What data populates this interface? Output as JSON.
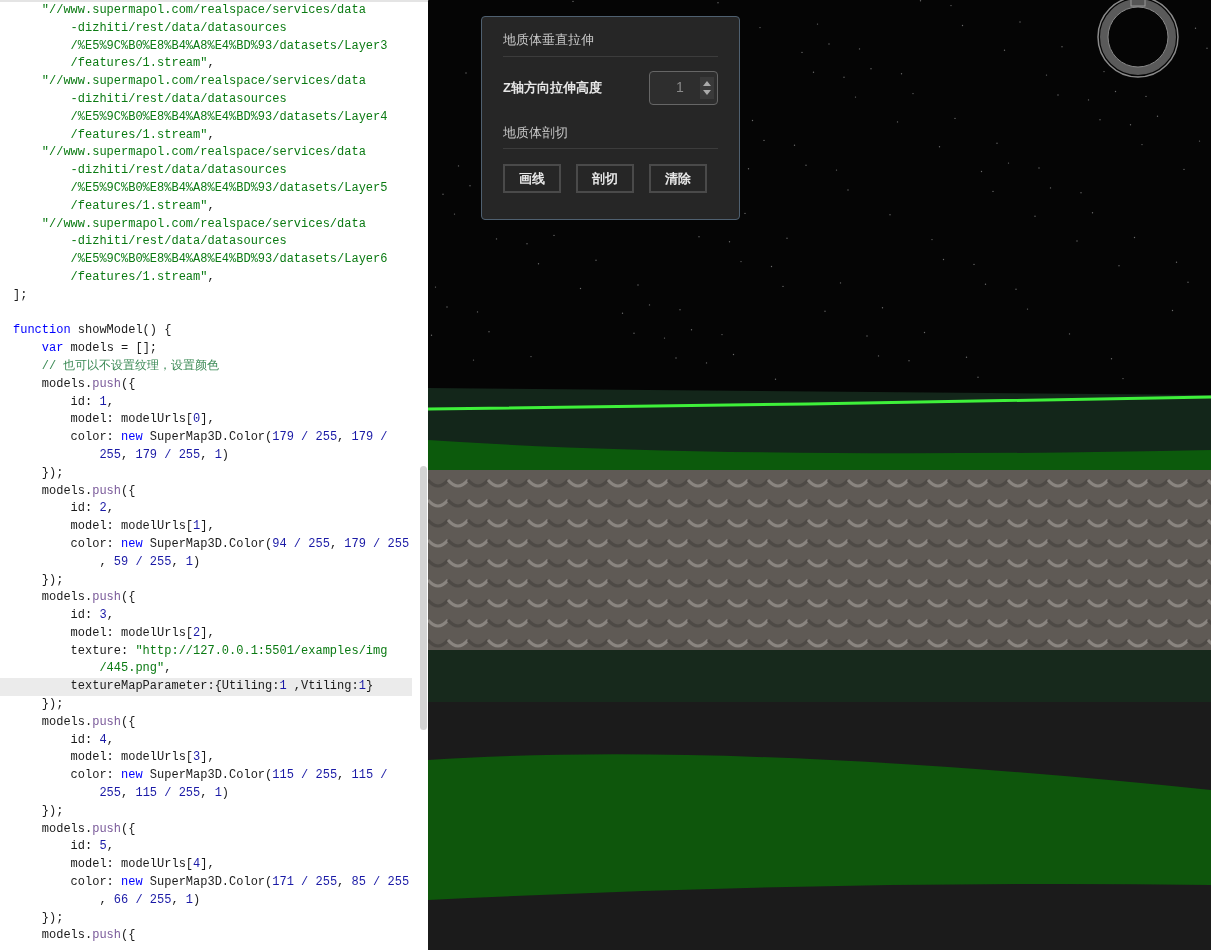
{
  "editor": {
    "lines": [
      {
        "kind": "code",
        "current": false,
        "segments": [
          {
            "kind": "string",
            "text": "    \"//www.supermapol.com/realspace/services/data"
          }
        ]
      },
      {
        "kind": "code",
        "current": false,
        "segments": [
          {
            "kind": "string",
            "text": "        -dizhiti/rest/data/datasources"
          }
        ]
      },
      {
        "kind": "code",
        "current": false,
        "segments": [
          {
            "kind": "string",
            "text": "        /%E5%9C%B0%E8%B4%A8%E4%BD%93/datasets/Layer3"
          }
        ]
      },
      {
        "kind": "code",
        "current": false,
        "segments": [
          {
            "kind": "string",
            "text": "        /features/1.stream\""
          },
          {
            "kind": "plain",
            "text": ","
          }
        ]
      },
      {
        "kind": "code",
        "current": false,
        "segments": [
          {
            "kind": "string",
            "text": "    \"//www.supermapol.com/realspace/services/data"
          }
        ]
      },
      {
        "kind": "code",
        "current": false,
        "segments": [
          {
            "kind": "string",
            "text": "        -dizhiti/rest/data/datasources"
          }
        ]
      },
      {
        "kind": "code",
        "current": false,
        "segments": [
          {
            "kind": "string",
            "text": "        /%E5%9C%B0%E8%B4%A8%E4%BD%93/datasets/Layer4"
          }
        ]
      },
      {
        "kind": "code",
        "current": false,
        "segments": [
          {
            "kind": "string",
            "text": "        /features/1.stream\""
          },
          {
            "kind": "plain",
            "text": ","
          }
        ]
      },
      {
        "kind": "code",
        "current": false,
        "segments": [
          {
            "kind": "string",
            "text": "    \"//www.supermapol.com/realspace/services/data"
          }
        ]
      },
      {
        "kind": "code",
        "current": false,
        "segments": [
          {
            "kind": "string",
            "text": "        -dizhiti/rest/data/datasources"
          }
        ]
      },
      {
        "kind": "code",
        "current": false,
        "segments": [
          {
            "kind": "string",
            "text": "        /%E5%9C%B0%E8%B4%A8%E4%BD%93/datasets/Layer5"
          }
        ]
      },
      {
        "kind": "code",
        "current": false,
        "segments": [
          {
            "kind": "string",
            "text": "        /features/1.stream\""
          },
          {
            "kind": "plain",
            "text": ","
          }
        ]
      },
      {
        "kind": "code",
        "current": false,
        "segments": [
          {
            "kind": "string",
            "text": "    \"//www.supermapol.com/realspace/services/data"
          }
        ]
      },
      {
        "kind": "code",
        "current": false,
        "segments": [
          {
            "kind": "string",
            "text": "        -dizhiti/rest/data/datasources"
          }
        ]
      },
      {
        "kind": "code",
        "current": false,
        "segments": [
          {
            "kind": "string",
            "text": "        /%E5%9C%B0%E8%B4%A8%E4%BD%93/datasets/Layer6"
          }
        ]
      },
      {
        "kind": "code",
        "current": false,
        "segments": [
          {
            "kind": "string",
            "text": "        /features/1.stream\""
          },
          {
            "kind": "plain",
            "text": ","
          }
        ]
      },
      {
        "kind": "code",
        "current": false,
        "segments": [
          {
            "kind": "plain",
            "text": "];"
          }
        ]
      },
      {
        "kind": "blank"
      },
      {
        "kind": "code",
        "current": false,
        "segments": [
          {
            "kind": "keyword",
            "text": "function"
          },
          {
            "kind": "plain",
            "text": " showModel() {"
          }
        ]
      },
      {
        "kind": "code",
        "current": false,
        "segments": [
          {
            "kind": "keyword",
            "text": "    var"
          },
          {
            "kind": "plain",
            "text": " models = [];"
          }
        ]
      },
      {
        "kind": "code",
        "current": false,
        "segments": [
          {
            "kind": "comment",
            "text": "    // 也可以不设置纹理，设置颜色"
          }
        ]
      },
      {
        "kind": "code",
        "current": false,
        "segments": [
          {
            "kind": "plain",
            "text": "    models."
          },
          {
            "kind": "method",
            "text": "push"
          },
          {
            "kind": "plain",
            "text": "({"
          }
        ]
      },
      {
        "kind": "code",
        "current": false,
        "segments": [
          {
            "kind": "plain",
            "text": "        id: "
          },
          {
            "kind": "number",
            "text": "1"
          },
          {
            "kind": "plain",
            "text": ","
          }
        ]
      },
      {
        "kind": "code",
        "current": false,
        "segments": [
          {
            "kind": "plain",
            "text": "        model: modelUrls["
          },
          {
            "kind": "number",
            "text": "0"
          },
          {
            "kind": "plain",
            "text": "],"
          }
        ]
      },
      {
        "kind": "code",
        "current": false,
        "segments": [
          {
            "kind": "plain",
            "text": "        color: "
          },
          {
            "kind": "keyword",
            "text": "new"
          },
          {
            "kind": "plain",
            "text": " SuperMap3D.Color("
          },
          {
            "kind": "number",
            "text": "179 / 255"
          },
          {
            "kind": "plain",
            "text": ", "
          },
          {
            "kind": "number",
            "text": "179 /"
          }
        ]
      },
      {
        "kind": "code",
        "current": false,
        "segments": [
          {
            "kind": "number",
            "text": "            255"
          },
          {
            "kind": "plain",
            "text": ", "
          },
          {
            "kind": "number",
            "text": "179 / 255"
          },
          {
            "kind": "plain",
            "text": ", "
          },
          {
            "kind": "number",
            "text": "1"
          },
          {
            "kind": "plain",
            "text": ")"
          }
        ]
      },
      {
        "kind": "code",
        "current": false,
        "segments": [
          {
            "kind": "plain",
            "text": "    });"
          }
        ]
      },
      {
        "kind": "code",
        "current": false,
        "segments": [
          {
            "kind": "plain",
            "text": "    models."
          },
          {
            "kind": "method",
            "text": "push"
          },
          {
            "kind": "plain",
            "text": "({"
          }
        ]
      },
      {
        "kind": "code",
        "current": false,
        "segments": [
          {
            "kind": "plain",
            "text": "        id: "
          },
          {
            "kind": "number",
            "text": "2"
          },
          {
            "kind": "plain",
            "text": ","
          }
        ]
      },
      {
        "kind": "code",
        "current": false,
        "segments": [
          {
            "kind": "plain",
            "text": "        model: modelUrls["
          },
          {
            "kind": "number",
            "text": "1"
          },
          {
            "kind": "plain",
            "text": "],"
          }
        ]
      },
      {
        "kind": "code",
        "current": false,
        "segments": [
          {
            "kind": "plain",
            "text": "        color: "
          },
          {
            "kind": "keyword",
            "text": "new"
          },
          {
            "kind": "plain",
            "text": " SuperMap3D.Color("
          },
          {
            "kind": "number",
            "text": "94 / 255"
          },
          {
            "kind": "plain",
            "text": ", "
          },
          {
            "kind": "number",
            "text": "179 / 255"
          }
        ]
      },
      {
        "kind": "code",
        "current": false,
        "segments": [
          {
            "kind": "plain",
            "text": "            , "
          },
          {
            "kind": "number",
            "text": "59 / 255"
          },
          {
            "kind": "plain",
            "text": ", "
          },
          {
            "kind": "number",
            "text": "1"
          },
          {
            "kind": "plain",
            "text": ")"
          }
        ]
      },
      {
        "kind": "code",
        "current": false,
        "segments": [
          {
            "kind": "plain",
            "text": "    });"
          }
        ]
      },
      {
        "kind": "code",
        "current": false,
        "segments": [
          {
            "kind": "plain",
            "text": "    models."
          },
          {
            "kind": "method",
            "text": "push"
          },
          {
            "kind": "plain",
            "text": "({"
          }
        ]
      },
      {
        "kind": "code",
        "current": false,
        "segments": [
          {
            "kind": "plain",
            "text": "        id: "
          },
          {
            "kind": "number",
            "text": "3"
          },
          {
            "kind": "plain",
            "text": ","
          }
        ]
      },
      {
        "kind": "code",
        "current": false,
        "segments": [
          {
            "kind": "plain",
            "text": "        model: modelUrls["
          },
          {
            "kind": "number",
            "text": "2"
          },
          {
            "kind": "plain",
            "text": "],"
          }
        ]
      },
      {
        "kind": "code",
        "current": false,
        "segments": [
          {
            "kind": "plain",
            "text": "        texture: "
          },
          {
            "kind": "string",
            "text": "\"http://127.0.0.1:5501/examples/img"
          }
        ]
      },
      {
        "kind": "code",
        "current": false,
        "segments": [
          {
            "kind": "string",
            "text": "            /445.png\""
          },
          {
            "kind": "plain",
            "text": ","
          }
        ]
      },
      {
        "kind": "code",
        "current": true,
        "segments": [
          {
            "kind": "plain",
            "text": "        textureMapParameter:{Utiling:"
          },
          {
            "kind": "number",
            "text": "1"
          },
          {
            "kind": "plain",
            "text": " ,Vtiling:"
          },
          {
            "kind": "number",
            "text": "1"
          },
          {
            "kind": "plain",
            "text": "}"
          }
        ]
      },
      {
        "kind": "code",
        "current": false,
        "segments": [
          {
            "kind": "plain",
            "text": "    });"
          }
        ]
      },
      {
        "kind": "code",
        "current": false,
        "segments": [
          {
            "kind": "plain",
            "text": "    models."
          },
          {
            "kind": "method",
            "text": "push"
          },
          {
            "kind": "plain",
            "text": "({"
          }
        ]
      },
      {
        "kind": "code",
        "current": false,
        "segments": [
          {
            "kind": "plain",
            "text": "        id: "
          },
          {
            "kind": "number",
            "text": "4"
          },
          {
            "kind": "plain",
            "text": ","
          }
        ]
      },
      {
        "kind": "code",
        "current": false,
        "segments": [
          {
            "kind": "plain",
            "text": "        model: modelUrls["
          },
          {
            "kind": "number",
            "text": "3"
          },
          {
            "kind": "plain",
            "text": "],"
          }
        ]
      },
      {
        "kind": "code",
        "current": false,
        "segments": [
          {
            "kind": "plain",
            "text": "        color: "
          },
          {
            "kind": "keyword",
            "text": "new"
          },
          {
            "kind": "plain",
            "text": " SuperMap3D.Color("
          },
          {
            "kind": "number",
            "text": "115 / 255"
          },
          {
            "kind": "plain",
            "text": ", "
          },
          {
            "kind": "number",
            "text": "115 /"
          }
        ]
      },
      {
        "kind": "code",
        "current": false,
        "segments": [
          {
            "kind": "number",
            "text": "            255"
          },
          {
            "kind": "plain",
            "text": ", "
          },
          {
            "kind": "number",
            "text": "115 / 255"
          },
          {
            "kind": "plain",
            "text": ", "
          },
          {
            "kind": "number",
            "text": "1"
          },
          {
            "kind": "plain",
            "text": ")"
          }
        ]
      },
      {
        "kind": "code",
        "current": false,
        "segments": [
          {
            "kind": "plain",
            "text": "    });"
          }
        ]
      },
      {
        "kind": "code",
        "current": false,
        "segments": [
          {
            "kind": "plain",
            "text": "    models."
          },
          {
            "kind": "method",
            "text": "push"
          },
          {
            "kind": "plain",
            "text": "({"
          }
        ]
      },
      {
        "kind": "code",
        "current": false,
        "segments": [
          {
            "kind": "plain",
            "text": "        id: "
          },
          {
            "kind": "number",
            "text": "5"
          },
          {
            "kind": "plain",
            "text": ","
          }
        ]
      },
      {
        "kind": "code",
        "current": false,
        "segments": [
          {
            "kind": "plain",
            "text": "        model: modelUrls["
          },
          {
            "kind": "number",
            "text": "4"
          },
          {
            "kind": "plain",
            "text": "],"
          }
        ]
      },
      {
        "kind": "code",
        "current": false,
        "segments": [
          {
            "kind": "plain",
            "text": "        color: "
          },
          {
            "kind": "keyword",
            "text": "new"
          },
          {
            "kind": "plain",
            "text": " SuperMap3D.Color("
          },
          {
            "kind": "number",
            "text": "171 / 255"
          },
          {
            "kind": "plain",
            "text": ", "
          },
          {
            "kind": "number",
            "text": "85 / 255"
          }
        ]
      },
      {
        "kind": "code",
        "current": false,
        "segments": [
          {
            "kind": "plain",
            "text": "            , "
          },
          {
            "kind": "number",
            "text": "66 / 255"
          },
          {
            "kind": "plain",
            "text": ", "
          },
          {
            "kind": "number",
            "text": "1"
          },
          {
            "kind": "plain",
            "text": ")"
          }
        ]
      },
      {
        "kind": "code",
        "current": false,
        "segments": [
          {
            "kind": "plain",
            "text": "    });"
          }
        ]
      },
      {
        "kind": "code",
        "current": false,
        "segments": [
          {
            "kind": "plain",
            "text": "    models."
          },
          {
            "kind": "method",
            "text": "push"
          },
          {
            "kind": "plain",
            "text": "({"
          }
        ]
      }
    ]
  },
  "viewer": {
    "panel": {
      "stretch_title": "地质体垂直拉伸",
      "height_label": "Z轴方向拉伸高度",
      "height_value": "1",
      "cut_title": "地质体剖切",
      "buttons": [
        "画线",
        "剖切",
        "清除"
      ]
    }
  }
}
